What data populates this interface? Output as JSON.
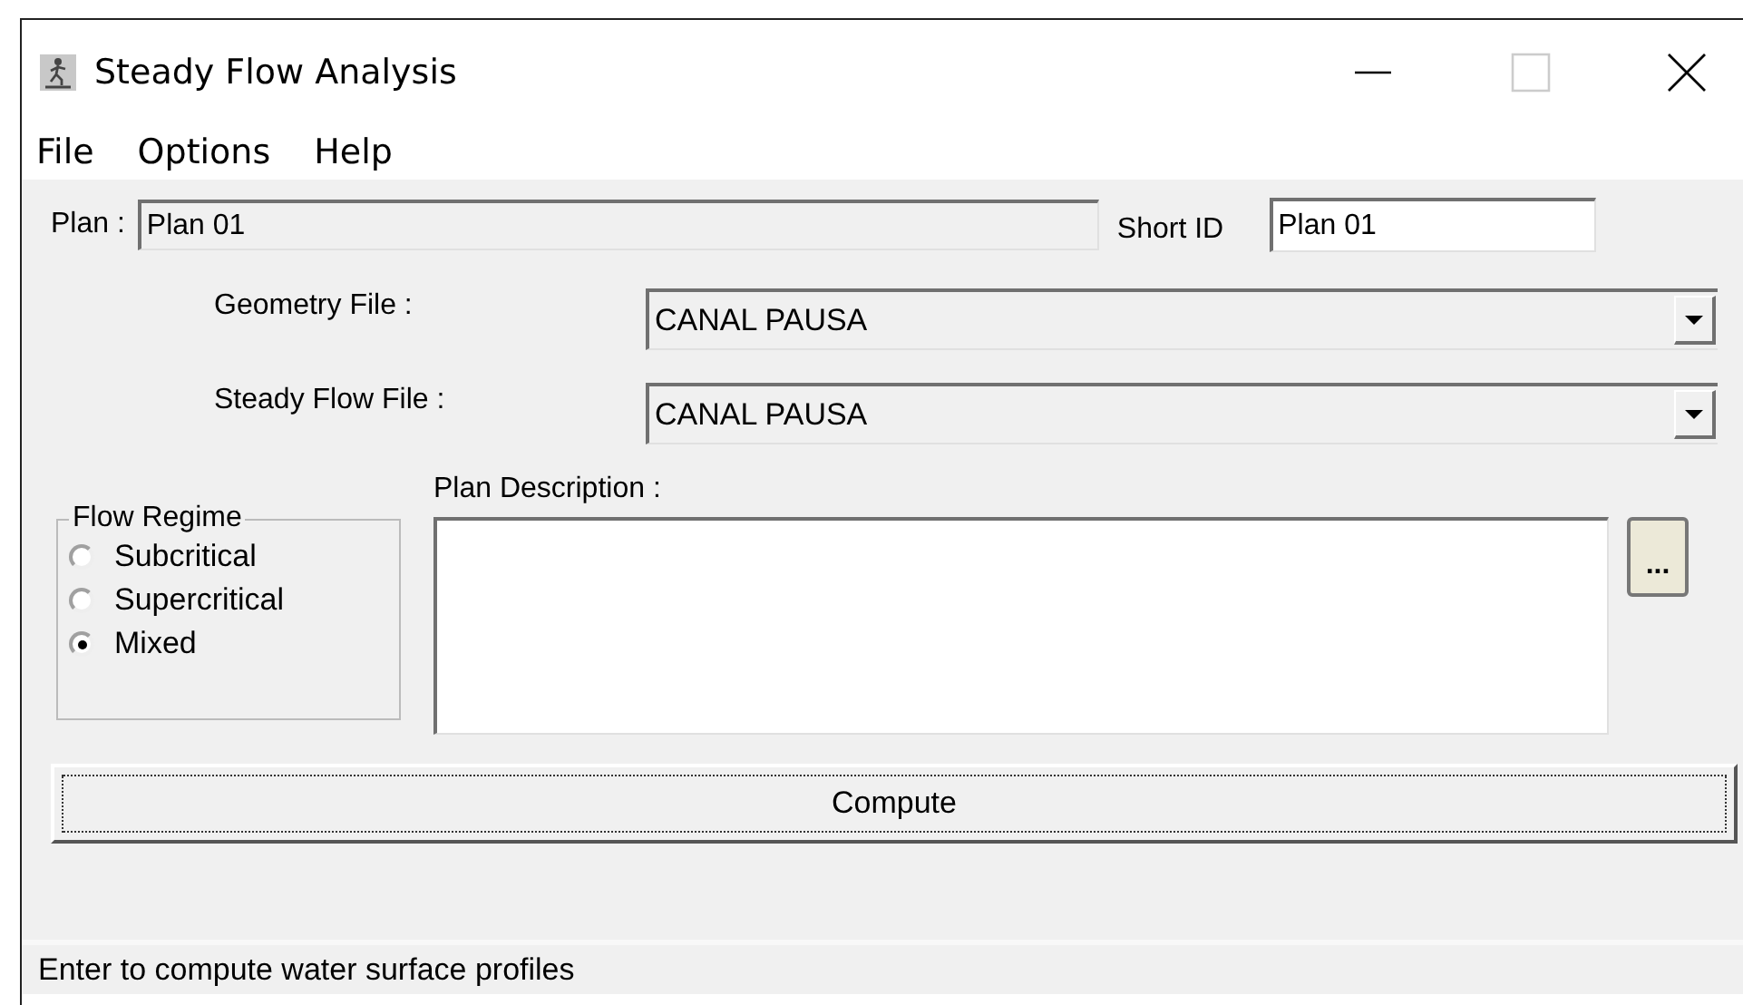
{
  "window": {
    "title": "Steady Flow Analysis"
  },
  "menu": [
    "File",
    "Options",
    "Help"
  ],
  "plan": {
    "label": "Plan :",
    "value": "Plan 01"
  },
  "short_id": {
    "label": "Short ID",
    "value": "Plan 01"
  },
  "files": [
    {
      "label": "Geometry File :",
      "value": "CANAL PAUSA"
    },
    {
      "label": "Steady Flow File :",
      "value": "CANAL PAUSA"
    }
  ],
  "flow_regime": {
    "title": "Flow Regime",
    "options": [
      {
        "label": "Subcritical",
        "selected": false
      },
      {
        "label": "Supercritical",
        "selected": false
      },
      {
        "label": "Mixed",
        "selected": true
      }
    ]
  },
  "plan_description": {
    "label": "Plan Description :",
    "browse_button": "..."
  },
  "compute_button": "Compute",
  "status_bar": "Enter to compute water surface profiles"
}
